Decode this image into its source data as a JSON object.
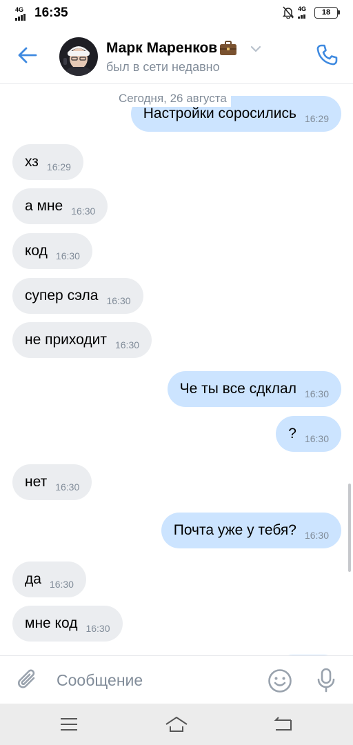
{
  "status_bar": {
    "time": "16:35",
    "network_left": "4G",
    "network_right": "4G",
    "battery": "18"
  },
  "header": {
    "contact_name": "Марк Маренков",
    "contact_status": "был в сети недавно"
  },
  "chat": {
    "date_separator": "Сегодня, 26 августа",
    "messages": [
      {
        "direction": "out",
        "text": "Настройки соросились",
        "time": "16:29"
      },
      {
        "direction": "in",
        "text": "хз",
        "time": "16:29"
      },
      {
        "direction": "in",
        "text": "а мне",
        "time": "16:30"
      },
      {
        "direction": "in",
        "text": "код",
        "time": "16:30"
      },
      {
        "direction": "in",
        "text": "супер сэла",
        "time": "16:30"
      },
      {
        "direction": "in",
        "text": "не приходит",
        "time": "16:30"
      },
      {
        "direction": "out",
        "text": "Че ты все сдклал",
        "time": "16:30"
      },
      {
        "direction": "out",
        "text": "?",
        "time": "16:30"
      },
      {
        "direction": "in",
        "text": "нет",
        "time": "16:30"
      },
      {
        "direction": "out",
        "text": "Почта уже у тебя?",
        "time": "16:30"
      },
      {
        "direction": "in",
        "text": "да",
        "time": "16:30"
      },
      {
        "direction": "in",
        "text": "мне код",
        "time": "16:30"
      }
    ]
  },
  "input": {
    "placeholder": "Сообщение",
    "value": ""
  },
  "icons": {
    "back": "arrow-left-icon",
    "call": "phone-icon",
    "attach": "paperclip-icon",
    "sticker": "smile-icon",
    "mic": "microphone-icon",
    "nav_menu": "menu-icon",
    "nav_home": "home-icon",
    "nav_back": "back-icon"
  },
  "colors": {
    "accent": "#3f8ae0",
    "incoming_bubble": "#ebedf0",
    "outgoing_bubble": "#cce4ff",
    "secondary_text": "#818c99"
  }
}
